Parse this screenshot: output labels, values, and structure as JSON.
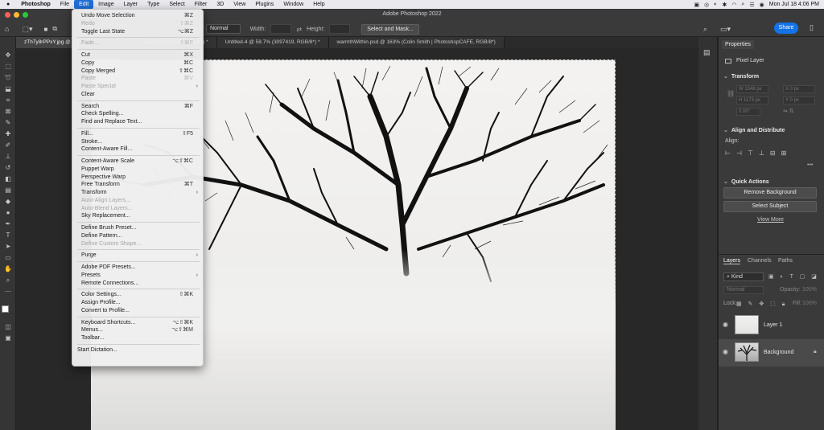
{
  "menubar": {
    "items": [
      "Photoshop",
      "File",
      "Edit",
      "Image",
      "Layer",
      "Type",
      "Select",
      "Filter",
      "3D",
      "View",
      "Plugins",
      "Window",
      "Help"
    ],
    "active_index": 2,
    "datetime": "Mon Jul 18  4:06 PM"
  },
  "app": {
    "title": "Adobe Photoshop 2022"
  },
  "options": {
    "style_value": "Normal",
    "width_label": "Width:",
    "height_label": "Height:",
    "select_mask_label": "Select and Mask...",
    "share_label": "Share"
  },
  "tabs": [
    "zThTy8rPPxY.jpg @",
    "58.7% (3097419, RGB/8*) *",
    "Untitled-4 @ 58.7% (3097419, RGB/8*) *",
    "warmthWithin.psd @ 163% (Colin Smith | PhotoshopCAFE, RGB/8*)"
  ],
  "edit_menu": {
    "items": [
      {
        "label": "Undo Move Selection",
        "shortcut": "⌘Z",
        "disabled": false
      },
      {
        "label": "Redo",
        "shortcut": "⇧⌘Z",
        "disabled": true
      },
      {
        "label": "Toggle Last State",
        "shortcut": "⌥⌘Z",
        "disabled": false
      },
      {
        "sep": true
      },
      {
        "label": "Fade...",
        "shortcut": "⇧⌘F",
        "disabled": true
      },
      {
        "sep": true
      },
      {
        "label": "Cut",
        "shortcut": "⌘X",
        "disabled": false
      },
      {
        "label": "Copy",
        "shortcut": "⌘C",
        "disabled": false
      },
      {
        "label": "Copy Merged",
        "shortcut": "⇧⌘C",
        "disabled": false
      },
      {
        "label": "Paste",
        "shortcut": "⌘V",
        "disabled": true
      },
      {
        "label": "Paste Special",
        "shortcut": "",
        "disabled": true,
        "submenu": true
      },
      {
        "label": "Clear",
        "shortcut": "",
        "disabled": false
      },
      {
        "sep": true
      },
      {
        "label": "Search",
        "shortcut": "⌘F",
        "disabled": false
      },
      {
        "label": "Check Spelling...",
        "shortcut": "",
        "disabled": false
      },
      {
        "label": "Find and Replace Text...",
        "shortcut": "",
        "disabled": false
      },
      {
        "sep": true
      },
      {
        "label": "Fill...",
        "shortcut": "⇧F5",
        "disabled": false
      },
      {
        "label": "Stroke...",
        "shortcut": "",
        "disabled": false
      },
      {
        "label": "Content-Aware Fill...",
        "shortcut": "",
        "disabled": false
      },
      {
        "sep": true
      },
      {
        "label": "Content-Aware Scale",
        "shortcut": "⌥⇧⌘C",
        "disabled": false
      },
      {
        "label": "Puppet Warp",
        "shortcut": "",
        "disabled": false
      },
      {
        "label": "Perspective Warp",
        "shortcut": "",
        "disabled": false
      },
      {
        "label": "Free Transform",
        "shortcut": "⌘T",
        "disabled": false
      },
      {
        "label": "Transform",
        "shortcut": "",
        "disabled": false,
        "submenu": true
      },
      {
        "label": "Auto-Align Layers...",
        "shortcut": "",
        "disabled": true
      },
      {
        "label": "Auto-Blend Layers...",
        "shortcut": "",
        "disabled": true
      },
      {
        "label": "Sky Replacement...",
        "shortcut": "",
        "disabled": false
      },
      {
        "sep": true
      },
      {
        "label": "Define Brush Preset...",
        "shortcut": "",
        "disabled": false
      },
      {
        "label": "Define Pattern...",
        "shortcut": "",
        "disabled": false
      },
      {
        "label": "Define Custom Shape...",
        "shortcut": "",
        "disabled": true
      },
      {
        "sep": true
      },
      {
        "label": "Purge",
        "shortcut": "",
        "disabled": false,
        "submenu": true
      },
      {
        "sep": true
      },
      {
        "label": "Adobe PDF Presets...",
        "shortcut": "",
        "disabled": false
      },
      {
        "label": "Presets",
        "shortcut": "",
        "disabled": false,
        "submenu": true
      },
      {
        "label": "Remote Connections...",
        "shortcut": "",
        "disabled": false
      },
      {
        "sep": true
      },
      {
        "label": "Color Settings...",
        "shortcut": "⇧⌘K",
        "disabled": false
      },
      {
        "label": "Assign Profile...",
        "shortcut": "",
        "disabled": false
      },
      {
        "label": "Convert to Profile...",
        "shortcut": "",
        "disabled": false
      },
      {
        "sep": true
      },
      {
        "label": "Keyboard Shortcuts...",
        "shortcut": "⌥⇧⌘K",
        "disabled": false
      },
      {
        "label": "Menus...",
        "shortcut": "⌥⇧⌘M",
        "disabled": false
      },
      {
        "label": "Toolbar...",
        "shortcut": "",
        "disabled": false
      },
      {
        "sep": true
      },
      {
        "label": "Start Dictation...",
        "shortcut": "",
        "disabled": false,
        "indent": -5
      }
    ]
  },
  "properties": {
    "tab": "Properties",
    "layer_type": "Pixel Layer",
    "transform_title": "Transform",
    "w_value": "W  1348 px",
    "h_value": "H  1173 px",
    "x_value": "X  0 px",
    "y_value": "Y  0 px",
    "angle_value": "0.00°",
    "align_title": "Align and Distribute",
    "align_label": "Align:",
    "quick_actions_title": "Quick Actions",
    "remove_bg_label": "Remove Background",
    "select_subject_label": "Select Subject",
    "view_more_label": "View More"
  },
  "layers": {
    "tabs": [
      "Layers",
      "Channels",
      "Paths"
    ],
    "filter_label": "Kind",
    "blend_mode": "Normal",
    "opacity_label": "Opacity:",
    "opacity_value": "100%",
    "lock_label": "Lock:",
    "fill_label": "Fill:",
    "fill_value": "100%",
    "items": [
      {
        "name": "Layer 1",
        "selected": false
      },
      {
        "name": "Background",
        "selected": true
      }
    ]
  }
}
